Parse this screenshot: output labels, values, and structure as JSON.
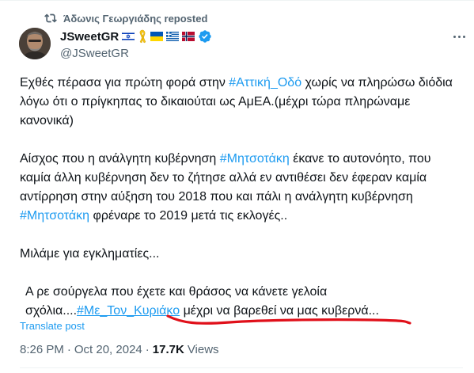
{
  "repost": {
    "text": "Άδωνις Γεωργιάδης reposted"
  },
  "author": {
    "display_name": "JSweetGR",
    "handle": "@JSweetGR",
    "badges": [
      "israel-flag-icon",
      "yellow-ribbon-icon",
      "ukraine-flag-icon",
      "greece-flag-icon",
      "norway-flag-icon",
      "verified-badge-icon"
    ]
  },
  "tweet": {
    "p1_a": "Εχθές πέρασα για πρώτη φορά στην ",
    "p1_tag": "#Αττική_Οδό",
    "p1_b": " χωρίς να πληρώσω διόδια λόγω ότι ο πρίγκηπας το δικαιούται ως ΑμΕΑ.(μέχρι τώρα πληρώναμε κανονικά)",
    "p2_a": "Αίσχος που η ανάλγητη κυβέρνηση ",
    "p2_tag1": "#Μητσοτάκη",
    "p2_b": " έκανε το αυτονόητο, που καμία άλλη κυβέρνηση δεν το ζήτησε αλλά εν αντιθέσει δεν έφεραν καμία αντίρρηση στην αύξηση του 2018 που και πάλι η ανάλγητη κυβέρνηση ",
    "p2_tag2": "#Μητσοτάκη",
    "p2_c": " φρέναρε το 2019 μετά τις εκλογές..",
    "p3": "Μιλάμε για εγκληματίες...",
    "p4_a": "Α ρε σούργελα που έχετε και θράσος να κάνετε γελοία σχόλια....",
    "p4_tag": "#Με_Τον_Κυριάκο",
    "p4_b": " μέχρι να βαρεθεί να μας κυβερνά..."
  },
  "translate": "Translate post",
  "meta": {
    "time": "8:26 PM",
    "date": "Oct 20, 2024",
    "views_count": "17.7K",
    "views_label": "Views"
  },
  "colors": {
    "link": "#1d9bf0",
    "muted": "#536471",
    "annotation": "#e0101a"
  }
}
